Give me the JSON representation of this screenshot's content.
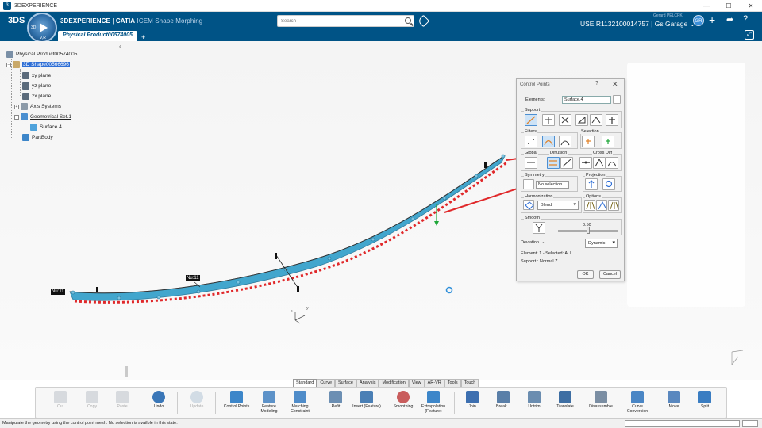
{
  "window": {
    "title": "3DEXPERIENCE",
    "minimize": "—",
    "maximize": "☐",
    "close": "✕"
  },
  "topbar": {
    "logo": "3DS",
    "compass_num1": "3D",
    "compass_num2": "V,R",
    "brand_main": "3DEXPERIENCE",
    "brand_sep": " | ",
    "brand_catia": "CATIA",
    "brand_app": " ICEM Shape Morphing",
    "tab": "Physical Product00574005",
    "tab_add": "+",
    "search_placeholder": "Search",
    "user": "Gerard PELCPK",
    "context": "USE R1132100014757 | Gs Garage",
    "context_chevron": "⌄",
    "avatar": "GR",
    "plus": "+",
    "share": "➦",
    "help": "?",
    "maximize": "⤢"
  },
  "tree": {
    "collapse": "‹",
    "expand_minus": "−",
    "expand_plus": "+",
    "root": "Physical Product00574005",
    "shape": "3D Shape00566696",
    "items": [
      "xy plane",
      "yz plane",
      "zx plane",
      "Axis Systems",
      "Geometrical Set.1",
      "Surface.4",
      "PartBody"
    ]
  },
  "viewport_labels": {
    "nu11_left": "Nu:11",
    "nu11_mid": "Nu:11",
    "axis_y": "y",
    "axis_x": "x"
  },
  "dialog": {
    "title": "Control Points",
    "help": "?",
    "close": "✕",
    "elements_label": "Elements:",
    "elements_value": "Surface.4",
    "support": "Support",
    "filters": "Filters",
    "selection": "Selection",
    "global": "Global",
    "diffusion": "Diffusion",
    "cross_diff": "Cross Diff",
    "symmetry": "Symmetry",
    "symmetry_value": "No selection",
    "projection": "Projection",
    "harmonization": "Harmonization",
    "harmonization_value": "Blend",
    "options": "Options",
    "smooth": "Smooth",
    "smooth_value": "0.50",
    "deviation": "Deviation : -",
    "deviation_mode": "Dynamic",
    "element_info": "Element:  1 - Selected: ALL",
    "support_info": "Support : Normal Z",
    "ok": "OK",
    "cancel": "Cancel"
  },
  "workbench_tabs": [
    "Standard",
    "Curve",
    "Surface",
    "Analysis",
    "Modification",
    "View",
    "AR-VR",
    "Tools",
    "Touch"
  ],
  "active_tab": "Modification",
  "tools": [
    {
      "label": "Cut",
      "icon": "scissors-icon",
      "disabled": true
    },
    {
      "label": "Copy",
      "icon": "copy-icon",
      "disabled": true
    },
    {
      "label": "Paste",
      "icon": "paste-icon",
      "disabled": true
    },
    {
      "label": "Undo",
      "icon": "undo-icon",
      "disabled": false
    },
    {
      "label": "Update",
      "icon": "update-icon",
      "disabled": true
    },
    {
      "label": "Control Points",
      "icon": "control-points-icon",
      "disabled": false
    },
    {
      "label": "Feature Modeling",
      "icon": "feature-modeling-icon",
      "disabled": false
    },
    {
      "label": "Matching Constraint",
      "icon": "matching-constraint-icon",
      "disabled": false
    },
    {
      "label": "Refit",
      "icon": "refit-icon",
      "disabled": false
    },
    {
      "label": "Insert (Feature)",
      "icon": "insert-icon",
      "disabled": false
    },
    {
      "label": "Smoothing",
      "icon": "smoothing-icon",
      "disabled": false
    },
    {
      "label": "Extrapolation (Feature)",
      "icon": "extrapolation-icon",
      "disabled": false
    },
    {
      "label": "Join",
      "icon": "join-icon",
      "disabled": false
    },
    {
      "label": "Break...",
      "icon": "break-icon",
      "disabled": false
    },
    {
      "label": "Untrim",
      "icon": "untrim-icon",
      "disabled": false
    },
    {
      "label": "Translate",
      "icon": "translate-icon",
      "disabled": false
    },
    {
      "label": "Disassemble",
      "icon": "disassemble-icon",
      "disabled": false
    },
    {
      "label": "Curve Conversion",
      "icon": "curve-conversion-icon",
      "disabled": false
    },
    {
      "label": "Move",
      "icon": "move-icon",
      "disabled": false
    },
    {
      "label": "Split",
      "icon": "split-icon",
      "disabled": false
    }
  ],
  "status": "Manipulate the geometry using the control point mesh. No selection is availble in this state.",
  "colors": {
    "brand": "#005386",
    "surface": "#2f9ec9",
    "highlight_red": "#e0282a",
    "selection": "#2f6fd6"
  }
}
